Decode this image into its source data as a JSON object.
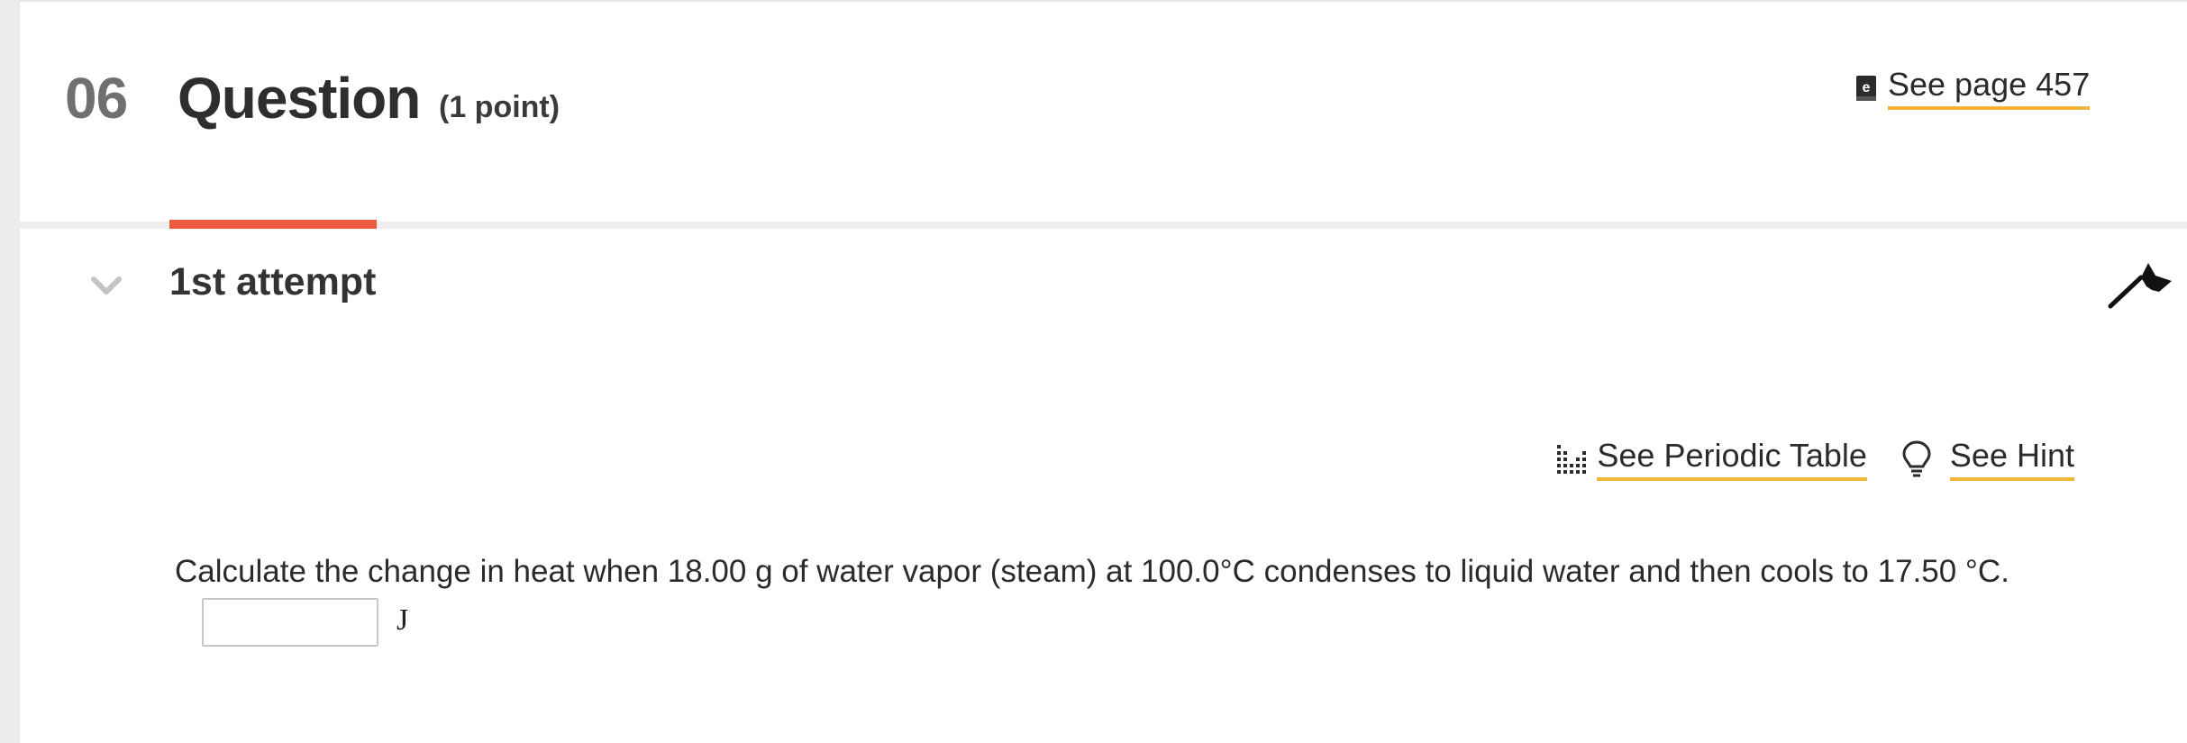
{
  "question": {
    "number": "06",
    "title": "Question",
    "points": "(1 point)",
    "see_page_label": "See page 457"
  },
  "attempt": {
    "title": "1st attempt"
  },
  "tools": {
    "periodic_table_label": "See Periodic Table",
    "hint_label": "See Hint"
  },
  "problem": {
    "prompt": "Calculate the change in heat when 18.00  g of water vapor (steam) at 100.0°C condenses to liquid water and then cools to 17.50 °C.",
    "answer_value": "",
    "unit": "J"
  },
  "colors": {
    "accent_tab": "#ee5a40",
    "link_underline": "#f0b53a",
    "question_number": "#707070"
  },
  "icons": {
    "see_page": "ebook-icon",
    "attempt_toggle": "chevron-down-icon",
    "flag": "flag-icon",
    "periodic_table": "periodic-table-icon",
    "hint": "lightbulb-icon"
  }
}
